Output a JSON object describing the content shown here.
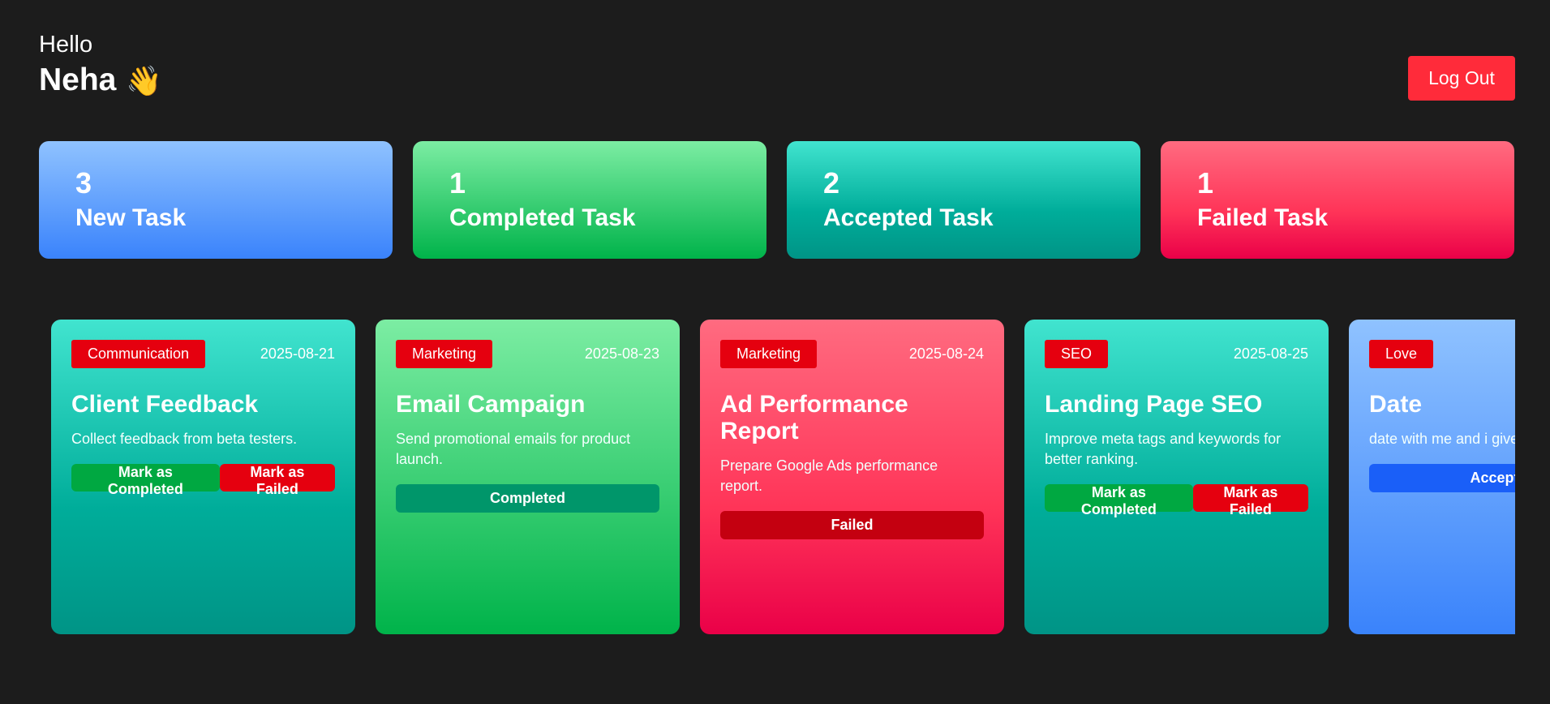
{
  "header": {
    "greeting": "Hello",
    "user_name": "Neha",
    "wave_emoji": "👋",
    "logout_label": "Log Out"
  },
  "stats": [
    {
      "count": "3",
      "label": "New Task"
    },
    {
      "count": "1",
      "label": "Completed Task"
    },
    {
      "count": "2",
      "label": "Accepted Task"
    },
    {
      "count": "1",
      "label": "Failed Task"
    }
  ],
  "tasks": [
    {
      "category": "Communication",
      "date": "2025-08-21",
      "title": "Client Feedback",
      "description": "Collect feedback from beta testers.",
      "complete_label": "Mark as Completed",
      "fail_label": "Mark as Failed"
    },
    {
      "category": "Marketing",
      "date": "2025-08-23",
      "title": "Email Campaign",
      "description": "Send promotional emails for product launch.",
      "status_label": "Completed"
    },
    {
      "category": "Marketing",
      "date": "2025-08-24",
      "title": "Ad Performance Report",
      "description": "Prepare Google Ads performance report.",
      "status_label": "Failed"
    },
    {
      "category": "SEO",
      "date": "2025-08-25",
      "title": "Landing Page SEO",
      "description": "Improve meta tags and keywords for better ranking.",
      "complete_label": "Mark as Completed",
      "fail_label": "Mark as Failed"
    },
    {
      "category": "Love",
      "date": "",
      "title": "Date",
      "description": "date with me and i give",
      "status_label": "Accept T"
    }
  ],
  "colors": {
    "background": "#1c1c1c",
    "logout": "#ff2b3a",
    "tag": "#e5000f",
    "complete_button": "#00a841",
    "fail_button": "#e5000f",
    "completed_status": "#00966a",
    "failed_status": "#c40010",
    "accept_button": "#1a5ff8"
  }
}
